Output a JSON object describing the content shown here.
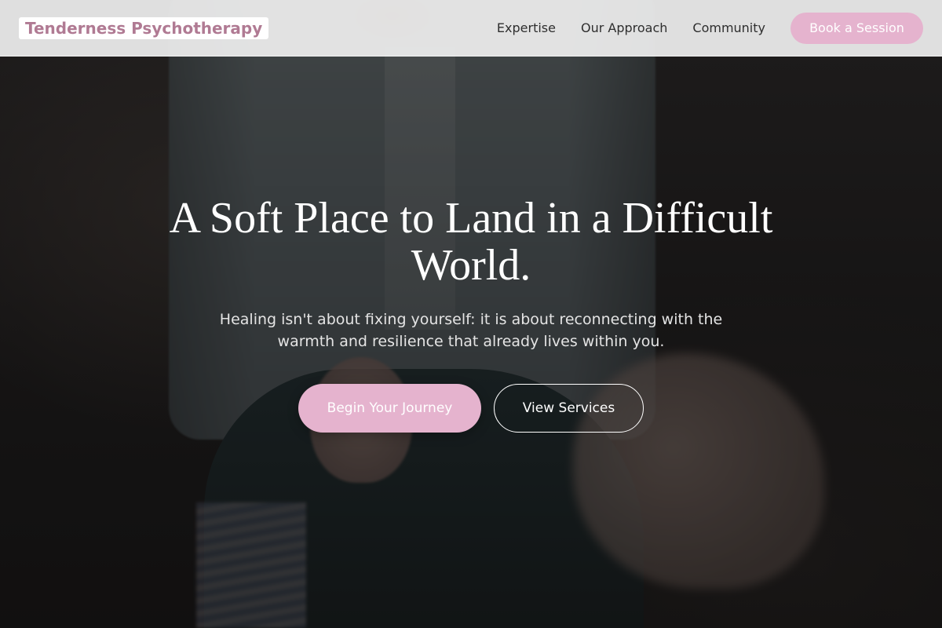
{
  "brand": {
    "name": "Tenderness Psychotherapy",
    "color": "#b07a93"
  },
  "nav": {
    "links": [
      {
        "label": "Expertise"
      },
      {
        "label": "Our Approach"
      },
      {
        "label": "Community"
      }
    ],
    "cta_label": "Book a Session"
  },
  "hero": {
    "title": "A Soft Place to Land in a Difficult World.",
    "subtitle": "Healing isn't about fixing yourself: it is about reconnecting with the warmth and resilience that already lives within you.",
    "primary_button": "Begin Your Journey",
    "secondary_button": "View Services",
    "background_image": "person-in-denim-jacket-holding-hands-in-therapy-session"
  },
  "colors": {
    "accent": "#e5b3ce",
    "navbar_bg": "#f0f0f0",
    "text_light": "#ffffff"
  }
}
